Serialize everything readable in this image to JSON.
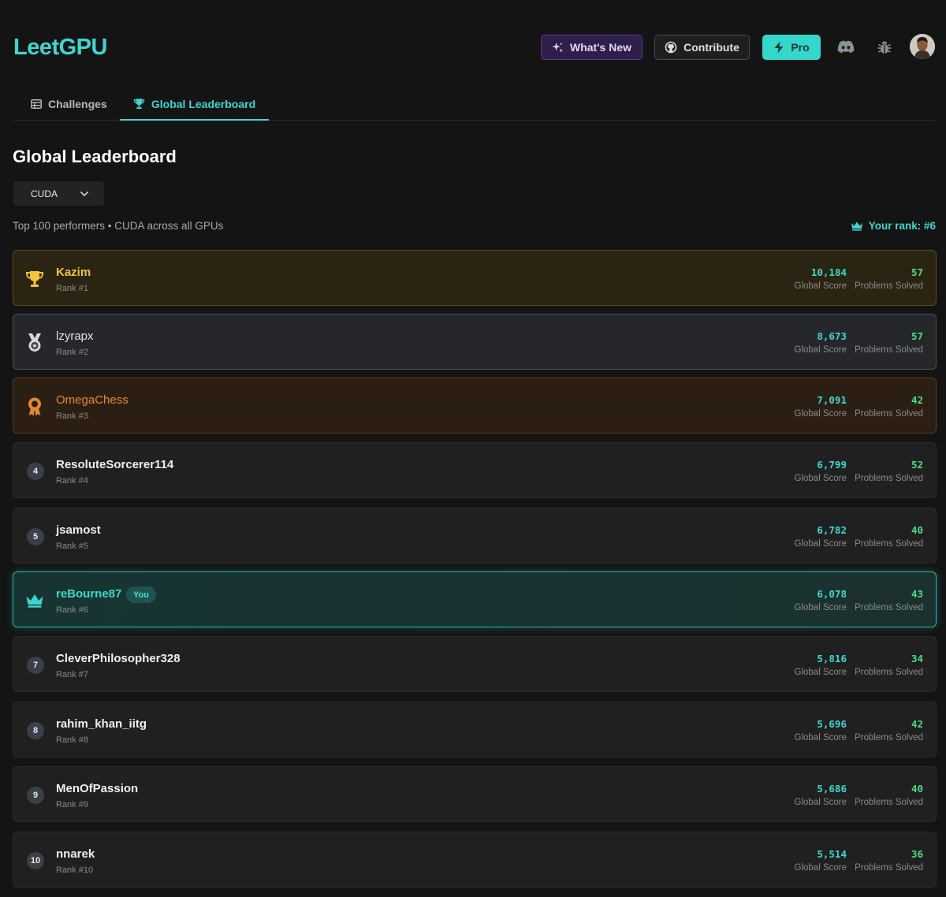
{
  "app": {
    "logo": "LeetGPU"
  },
  "header": {
    "whats_new": "What's New",
    "contribute": "Contribute",
    "pro": "Pro",
    "icons": [
      "sparkles-icon",
      "github-icon",
      "lightning-icon",
      "discord-icon",
      "bug-icon"
    ]
  },
  "tabs": [
    {
      "label": "Challenges",
      "icon": "table-icon",
      "active": false
    },
    {
      "label": "Global Leaderboard",
      "icon": "trophy-icon",
      "active": true
    }
  ],
  "page": {
    "title": "Global Leaderboard",
    "language_select": "CUDA",
    "subtitle": "Top 100 performers • CUDA across all GPUs",
    "your_rank": "Your rank: #6"
  },
  "labels": {
    "score": "Global Score",
    "solved": "Problems Solved",
    "you": "You"
  },
  "leaderboard": [
    {
      "name": "Kazim",
      "rank_label": "Rank #1",
      "rank": "1",
      "score": "10,184",
      "solved": "57",
      "tier": "gold"
    },
    {
      "name": "lzyrapx",
      "rank_label": "Rank #2",
      "rank": "2",
      "score": "8,673",
      "solved": "57",
      "tier": "silver"
    },
    {
      "name": "OmegaChess",
      "rank_label": "Rank #3",
      "rank": "3",
      "score": "7,091",
      "solved": "42",
      "tier": "bronze"
    },
    {
      "name": "ResoluteSorcerer114",
      "rank_label": "Rank #4",
      "rank": "4",
      "score": "6,799",
      "solved": "52",
      "tier": "normal"
    },
    {
      "name": "jsamost",
      "rank_label": "Rank #5",
      "rank": "5",
      "score": "6,782",
      "solved": "40",
      "tier": "normal"
    },
    {
      "name": "reBourne87",
      "rank_label": "Rank #6",
      "rank": "6",
      "score": "6,078",
      "solved": "43",
      "tier": "you"
    },
    {
      "name": "CleverPhilosopher328",
      "rank_label": "Rank #7",
      "rank": "7",
      "score": "5,816",
      "solved": "34",
      "tier": "normal"
    },
    {
      "name": "rahim_khan_iitg",
      "rank_label": "Rank #8",
      "rank": "8",
      "score": "5,696",
      "solved": "42",
      "tier": "normal"
    },
    {
      "name": "MenOfPassion",
      "rank_label": "Rank #9",
      "rank": "9",
      "score": "5,686",
      "solved": "40",
      "tier": "normal"
    },
    {
      "name": "nnarek",
      "rank_label": "Rank #10",
      "rank": "10",
      "score": "5,514",
      "solved": "36",
      "tier": "normal"
    }
  ],
  "colors": {
    "accent": "#3fd6cf",
    "gold": "#f3c33a",
    "bronze": "#e48a2e",
    "solved": "#4ade80"
  }
}
